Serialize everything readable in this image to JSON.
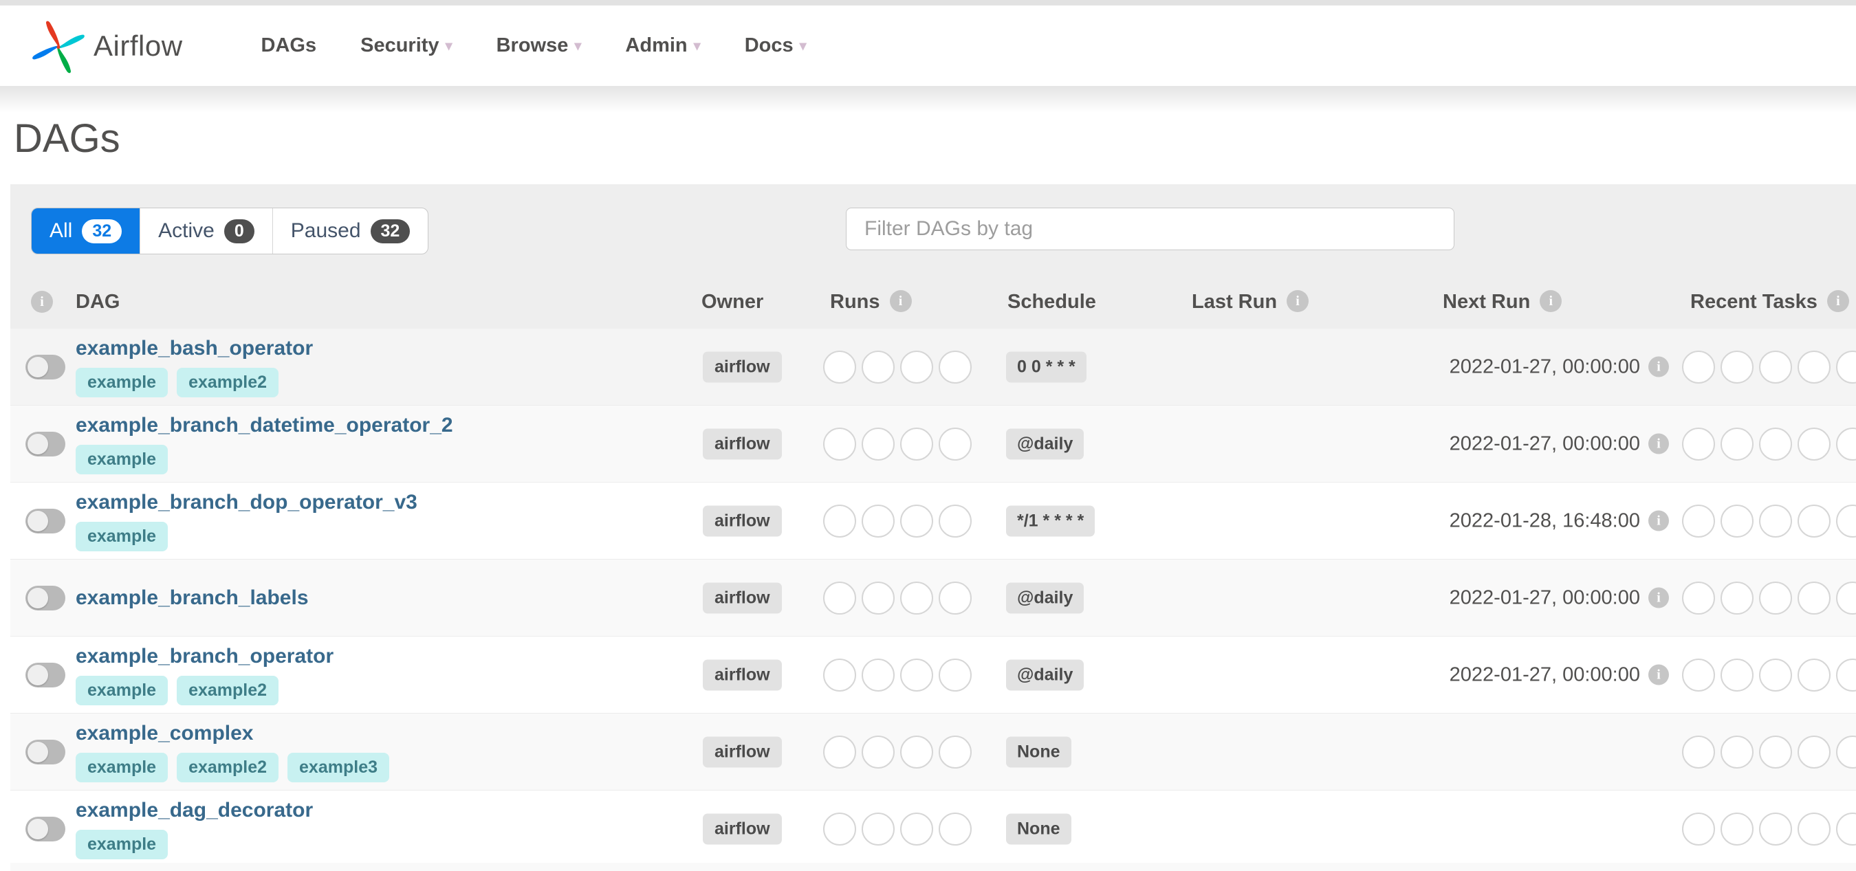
{
  "nav": {
    "brand": "Airflow",
    "items": [
      {
        "label": "DAGs",
        "caret": false
      },
      {
        "label": "Security",
        "caret": true
      },
      {
        "label": "Browse",
        "caret": true
      },
      {
        "label": "Admin",
        "caret": true
      },
      {
        "label": "Docs",
        "caret": true
      }
    ]
  },
  "page": {
    "title": "DAGs"
  },
  "filters": {
    "tabs": [
      {
        "label": "All",
        "count": "32",
        "active": true
      },
      {
        "label": "Active",
        "count": "0",
        "active": false
      },
      {
        "label": "Paused",
        "count": "32",
        "active": false
      }
    ],
    "search_placeholder": "Filter DAGs by tag"
  },
  "table": {
    "header": {
      "dag": "DAG",
      "owner": "Owner",
      "runs": "Runs",
      "schedule": "Schedule",
      "last_run": "Last Run",
      "next_run": "Next Run",
      "recent_tasks": "Recent Tasks"
    },
    "runs_circle_count": 4,
    "recent_circle_count": 5,
    "rows": [
      {
        "name": "example_bash_operator",
        "tags": [
          "example",
          "example2"
        ],
        "owner": "airflow",
        "schedule": "0 0 * * *",
        "last_run": "",
        "next_run": "2022-01-27, 00:00:00",
        "paused": true,
        "bg": "#f4f4f4"
      },
      {
        "name": "example_branch_datetime_operator_2",
        "tags": [
          "example"
        ],
        "owner": "airflow",
        "schedule": "@daily",
        "last_run": "",
        "next_run": "2022-01-27, 00:00:00",
        "paused": true,
        "bg": "#f9f9f9"
      },
      {
        "name": "example_branch_dop_operator_v3",
        "tags": [
          "example"
        ],
        "owner": "airflow",
        "schedule": "*/1 * * * *",
        "last_run": "",
        "next_run": "2022-01-28, 16:48:00",
        "paused": true,
        "bg": "#ffffff"
      },
      {
        "name": "example_branch_labels",
        "tags": [],
        "owner": "airflow",
        "schedule": "@daily",
        "last_run": "",
        "next_run": "2022-01-27, 00:00:00",
        "paused": true,
        "bg": "#f9f9f9"
      },
      {
        "name": "example_branch_operator",
        "tags": [
          "example",
          "example2"
        ],
        "owner": "airflow",
        "schedule": "@daily",
        "last_run": "",
        "next_run": "2022-01-27, 00:00:00",
        "paused": true,
        "bg": "#ffffff"
      },
      {
        "name": "example_complex",
        "tags": [
          "example",
          "example2",
          "example3"
        ],
        "owner": "airflow",
        "schedule": "None",
        "last_run": "",
        "next_run": "",
        "paused": true,
        "bg": "#f9f9f9"
      },
      {
        "name": "example_dag_decorator",
        "tags": [
          "example"
        ],
        "owner": "airflow",
        "schedule": "None",
        "last_run": "",
        "next_run": "",
        "paused": true,
        "bg": "#ffffff"
      }
    ]
  },
  "colors": {
    "active_tab_blue": "#0d7be5",
    "tag_pill_bg": "#c8f1f1",
    "tag_pill_text": "#3e7d87",
    "dag_link": "#38698c",
    "badge_bg": "#e2e2e2",
    "panel_bg": "#eeeeee",
    "logo_red": "#e43921",
    "logo_cyan": "#00c7d4",
    "logo_blue": "#017cee",
    "logo_green": "#00ad46"
  }
}
